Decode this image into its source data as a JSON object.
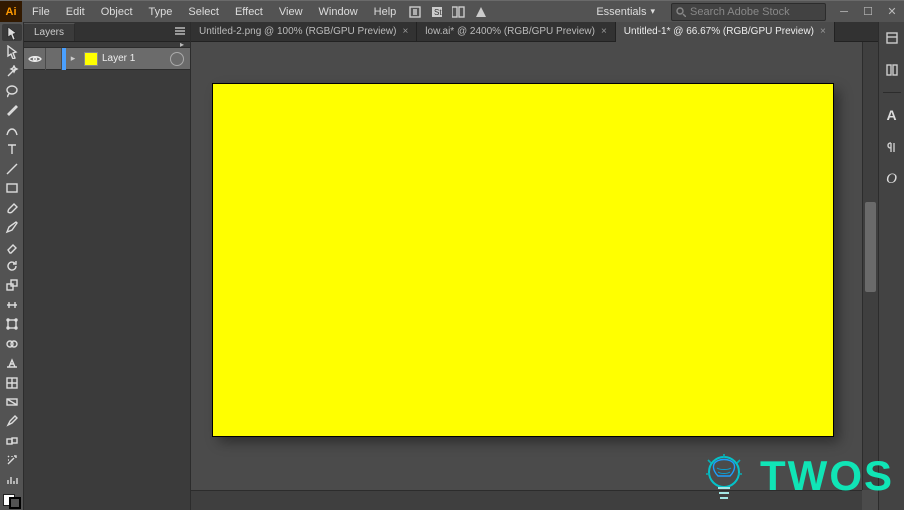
{
  "menubar": {
    "items": [
      "File",
      "Edit",
      "Object",
      "Type",
      "Select",
      "Effect",
      "View",
      "Window",
      "Help"
    ],
    "workspace_label": "Essentials",
    "search_placeholder": "Search Adobe Stock"
  },
  "layers_panel": {
    "tab_label": "Layers",
    "rows": [
      {
        "name": "Layer 1",
        "swatch_color": "#ffff00"
      }
    ]
  },
  "document_tabs": [
    {
      "label": "Untitled-2.png @ 100% (RGB/GPU Preview)",
      "active": false
    },
    {
      "label": "low.ai* @ 2400% (RGB/GPU Preview)",
      "active": false
    },
    {
      "label": "Untitled-1* @ 66.67% (RGB/GPU Preview)",
      "active": true
    }
  ],
  "canvas": {
    "fill_color": "#ffff00"
  },
  "right_dock": {
    "icons": [
      "swatches-icon",
      "brushes-icon",
      "character-icon",
      "paragraph-icon",
      "glyphs-icon"
    ]
  },
  "watermark": {
    "text": "TWOS"
  }
}
